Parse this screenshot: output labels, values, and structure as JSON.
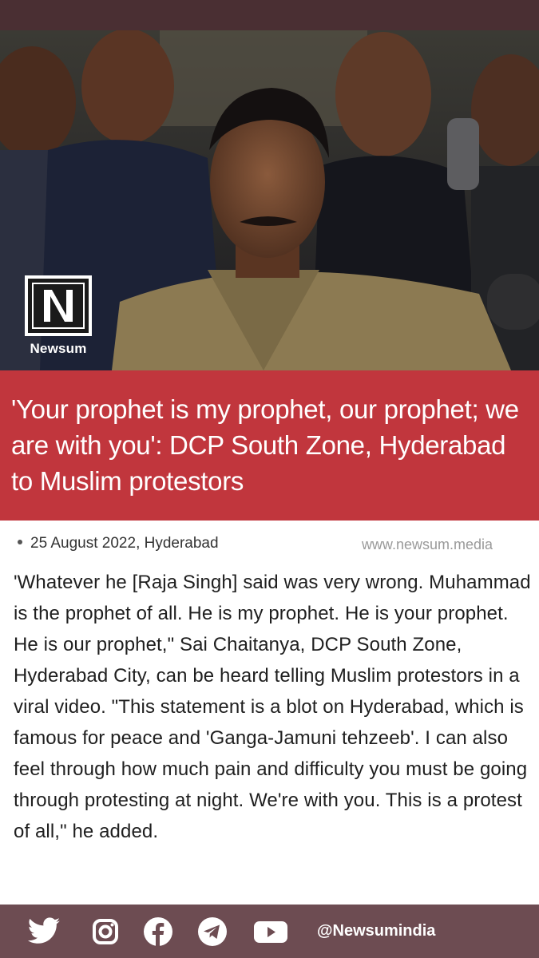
{
  "brand": {
    "logo_text": "Newsum",
    "website": "www.newsum.media",
    "social_handle": "@Newsumindia",
    "colors": {
      "topbar": "#4a2f33",
      "headline_bg": "#c1363d",
      "footer_bg": "#6d4c52"
    }
  },
  "article": {
    "headline": "'Your prophet is my prophet, our prophet; we are with you': DCP South Zone, Hyderabad to Muslim protestors",
    "dateline": "25 August 2022, Hyderabad",
    "body": "'Whatever he [Raja Singh] said was very wrong. Muhammad is the prophet of all. He is my prophet. He is your prophet. He is our prophet,\" Sai Chaitanya, DCP South Zone, Hyderabad City, can be heard telling Muslim protestors in a viral video. \"This statement is a blot on Hyderabad, which is famous for peace and 'Ganga-Jamuni tehzeeb'. I can also feel through how much pain and difficulty you must be going through protesting at night. We're with you. This is a protest of all,\" he added."
  },
  "footer": {
    "icons": [
      "twitter-icon",
      "instagram-icon",
      "facebook-icon",
      "telegram-icon",
      "youtube-icon"
    ]
  }
}
